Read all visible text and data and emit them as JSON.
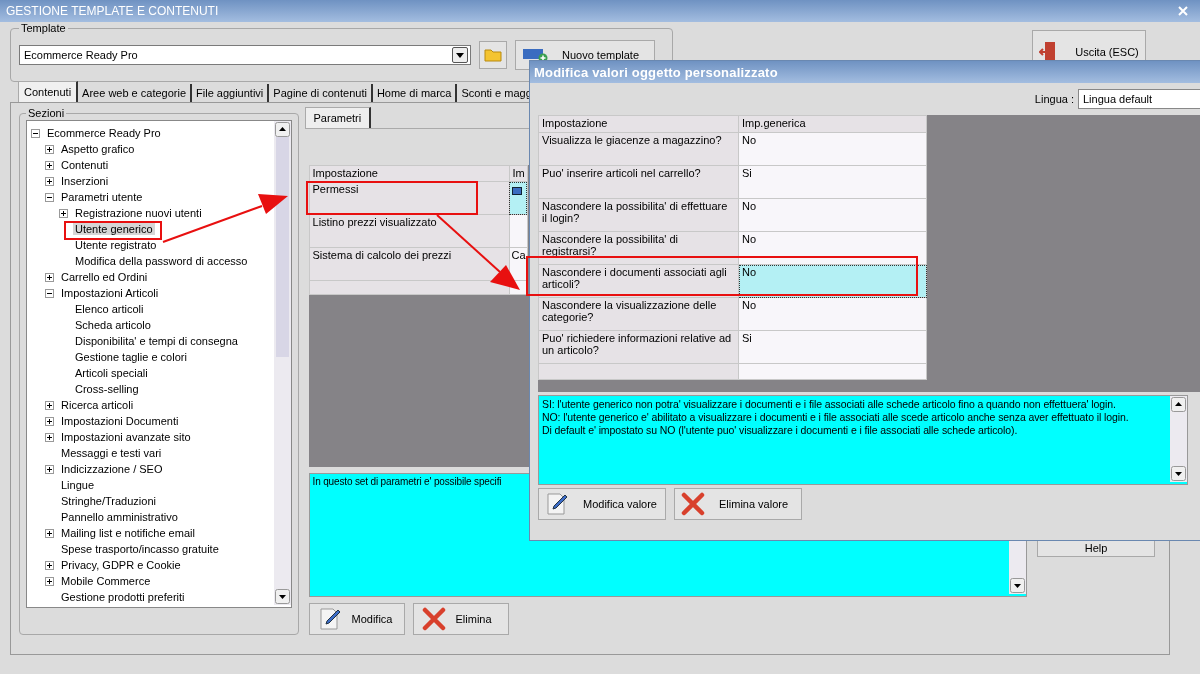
{
  "window": {
    "title": "GESTIONE TEMPLATE E CONTENUTI"
  },
  "template": {
    "legend": "Template",
    "value": "Ecommerce Ready Pro",
    "new_button": "Nuovo template"
  },
  "exit_button": "Uscita (ESC)",
  "tabs": [
    {
      "label": "Contenuti",
      "selected": true
    },
    {
      "label": "Aree web e categorie",
      "selected": false
    },
    {
      "label": "File aggiuntivi",
      "selected": false
    },
    {
      "label": "Pagine di contenuti",
      "selected": false
    },
    {
      "label": "Home di marca",
      "selected": false
    },
    {
      "label": "Sconti e magg",
      "selected": false
    }
  ],
  "sections": {
    "legend": "Sezioni",
    "tree": [
      {
        "label": "Ecommerce Ready Pro",
        "kind": "folder",
        "expanded": true,
        "selected": false,
        "children": [
          {
            "label": "Aspetto grafico",
            "kind": "folder",
            "expanded": false,
            "selected": false
          },
          {
            "label": "Contenuti",
            "kind": "folder",
            "expanded": false,
            "selected": false
          },
          {
            "label": "Inserzioni",
            "kind": "folder",
            "expanded": false,
            "selected": false
          },
          {
            "label": "Parametri utente",
            "kind": "folder",
            "expanded": true,
            "selected": false,
            "children": [
              {
                "label": "Registrazione nuovi utenti",
                "kind": "folder",
                "expanded": false,
                "selected": false
              },
              {
                "label": "Utente generico",
                "kind": "leaf",
                "selected": true
              },
              {
                "label": "Utente registrato",
                "kind": "leaf",
                "selected": false
              },
              {
                "label": "Modifica della password di accesso",
                "kind": "leaf",
                "selected": false
              }
            ]
          },
          {
            "label": "Carrello ed Ordini",
            "kind": "folder",
            "expanded": false,
            "selected": false
          },
          {
            "label": "Impostazioni Articoli",
            "kind": "folder",
            "expanded": true,
            "selected": false,
            "children": [
              {
                "label": "Elenco articoli",
                "kind": "leaf",
                "selected": false
              },
              {
                "label": "Scheda articolo",
                "kind": "leaf",
                "selected": false
              },
              {
                "label": "Disponibilita' e tempi di consegna",
                "kind": "leaf",
                "selected": false
              },
              {
                "label": "Gestione taglie e colori",
                "kind": "leaf",
                "selected": false
              },
              {
                "label": "Articoli speciali",
                "kind": "leaf",
                "selected": false
              },
              {
                "label": "Cross-selling",
                "kind": "leaf",
                "selected": false
              }
            ]
          },
          {
            "label": "Ricerca articoli",
            "kind": "folder",
            "expanded": false,
            "selected": false
          },
          {
            "label": "Impostazioni Documenti",
            "kind": "folder",
            "expanded": false,
            "selected": false
          },
          {
            "label": "Impostazioni avanzate sito",
            "kind": "folder",
            "expanded": false,
            "selected": false
          },
          {
            "label": "Messaggi e testi vari",
            "kind": "leaf",
            "selected": false
          },
          {
            "label": "Indicizzazione / SEO",
            "kind": "folder",
            "expanded": false,
            "selected": false
          },
          {
            "label": "Lingue",
            "kind": "leaf",
            "selected": false
          },
          {
            "label": "Stringhe/Traduzioni",
            "kind": "leaf",
            "selected": false
          },
          {
            "label": "Pannello amministrativo",
            "kind": "leaf",
            "selected": false
          },
          {
            "label": "Mailing list e notifiche email",
            "kind": "folder",
            "expanded": false,
            "selected": false
          },
          {
            "label": "Spese trasporto/incasso gratuite",
            "kind": "leaf",
            "selected": false
          },
          {
            "label": "Privacy, GDPR e Cookie",
            "kind": "folder",
            "expanded": false,
            "selected": false
          },
          {
            "label": "Mobile Commerce",
            "kind": "folder",
            "expanded": false,
            "selected": false
          },
          {
            "label": "Gestione prodotti preferiti",
            "kind": "leaf",
            "selected": false
          }
        ]
      }
    ]
  },
  "parameters": {
    "tab": "Parametri",
    "columns": [
      "Impostazione",
      "Im"
    ],
    "rows": [
      {
        "setting": "Permessi",
        "kind": "icon",
        "selected": true
      },
      {
        "setting": "Listino prezzi visualizzato",
        "kind": "text",
        "selected": false
      },
      {
        "setting": "Sistema di calcolo dei prezzi",
        "kind": "text",
        "value": "Ca",
        "selected": false
      }
    ],
    "description": "In questo set di parametri e' possibile specifi",
    "buttons": [
      "Modifica",
      "Elimina"
    ]
  },
  "help_button": "Help",
  "dialog": {
    "title": "Modifica valori oggetto personalizzato",
    "language_label": "Lingua :",
    "language": "Lingua default",
    "columns": [
      "Impostazione",
      "Imp.generica"
    ],
    "rows": [
      {
        "setting": "Visualizza le giacenze a magazzino?",
        "value": "No",
        "selected": false
      },
      {
        "setting": "Puo' inserire articoli nel carrello?",
        "value": "Si",
        "selected": false
      },
      {
        "setting": "Nascondere la possibilita' di effettuare il login?",
        "value": "No",
        "selected": false
      },
      {
        "setting": "Nascondere la possibilita' di registrarsi?",
        "value": "No",
        "selected": false
      },
      {
        "setting": "Nascondere i documenti associati agli articoli?",
        "value": "No",
        "selected": true
      },
      {
        "setting": "Nascondere la visualizzazione delle categorie?",
        "value": "No",
        "selected": false
      },
      {
        "setting": "Puo' richiedere informazioni relative ad un articolo?",
        "value": "Si",
        "selected": false
      }
    ],
    "description": [
      "SI: l'utente generico non potra' visualizzare i documenti e i file associati alle schede articolo fino a quando non effettuera' login.",
      "NO: l'utente generico e' abilitato a visualizzare i documenti e i file associati alle scede articolo anche senza aver effettuato il login.",
      "Di default e' impostato su NO (l'utente puo' visualizzare i documenti e i file associati alle schede articolo)."
    ],
    "buttons": [
      "Modifica valore",
      "Elimina valore"
    ]
  }
}
